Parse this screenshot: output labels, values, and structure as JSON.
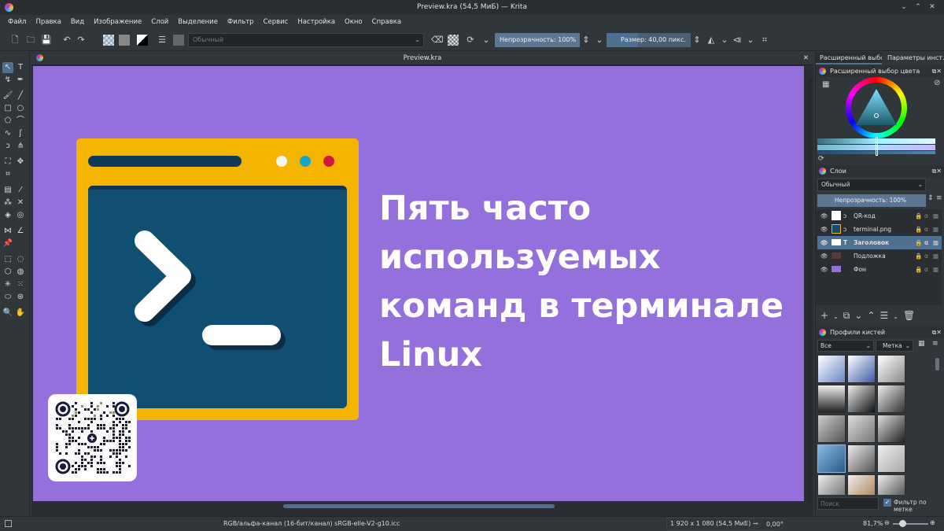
{
  "window": {
    "title": "Preview.kra (54,5 МиБ) — Krita"
  },
  "menu": {
    "items": [
      "Файл",
      "Правка",
      "Вид",
      "Изображение",
      "Слой",
      "Выделение",
      "Фильтр",
      "Сервис",
      "Настройка",
      "Окно",
      "Справка"
    ]
  },
  "toolbar": {
    "blend_mode": "Обычный",
    "opacity_label": "Непрозрачность: 100%",
    "size_label": "Размер: 40,00 пикс."
  },
  "document": {
    "tab_title": "Preview.kra",
    "headline_lines": [
      "Пять часто",
      "используемых",
      "команд в терминале",
      "Linux"
    ]
  },
  "right_panel": {
    "tabs": [
      "Расширенный выбо...",
      "Параметры инст..."
    ],
    "color_selector_title": "Расширенный выбор цвета",
    "layers_title": "Слои",
    "layers_blend": "Обычный",
    "layers_opacity": "Непрозрачность:  100%",
    "layers": [
      {
        "name": "QR-код",
        "selected": false,
        "thumb": "#ffffff"
      },
      {
        "name": "terminal.png",
        "selected": false,
        "thumb": "#104e72"
      },
      {
        "name": "Заголовок",
        "selected": true,
        "thumb": "#ffffff"
      },
      {
        "name": "Подложка",
        "selected": false,
        "thumb": "#5a3a3a"
      },
      {
        "name": "Фон",
        "selected": false,
        "thumb": "#9370db"
      }
    ],
    "brushes_title": "Профили кистей",
    "brush_filter": "Все",
    "brush_tag": "Метка",
    "search_placeholder": "Поиск",
    "filter_by_tag": "Фильтр по метке"
  },
  "statusbar": {
    "color_info": "RGB/альфа-канал (16-бит/канал)  sRGB-elle-V2-g10.icc",
    "dimensions": "1 920 x 1 080 (54,5 МиБ)",
    "rotation": "0,00°",
    "zoom": "81,7%"
  },
  "colors": {
    "canvas_bg": "#9370db",
    "terminal_frame": "#f5b400",
    "terminal_screen": "#104e72",
    "accent": "#4f7191",
    "dot_white": "#f4f4f4",
    "dot_cyan": "#18a5c8",
    "dot_red": "#d6173a"
  }
}
